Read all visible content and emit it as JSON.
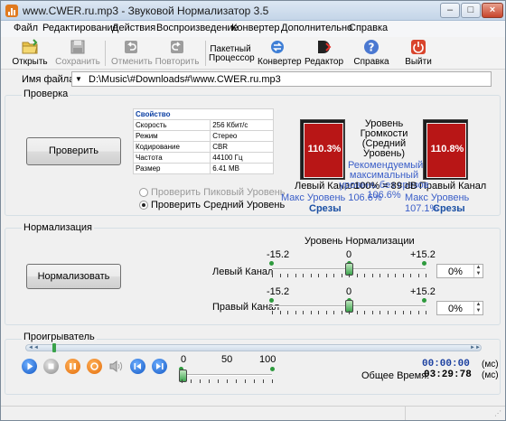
{
  "window": {
    "title": "www.CWER.ru.mp3 - Звуковой Нормализатор 3.5"
  },
  "menu": [
    "Файл",
    "Редактирование",
    "Действия",
    "Воспроизведение",
    "Конвертер",
    "Дополнительно",
    "Справка"
  ],
  "toolbar": {
    "open": "Открыть",
    "save": "Сохранить",
    "undo": "Отменить",
    "redo": "Повторить",
    "batch1": "Пакетный",
    "batch2": "Процессор",
    "converter": "Конвертер",
    "editor": "Редактор",
    "help": "Справка",
    "exit": "Выйти"
  },
  "file": {
    "label": "Имя файла:",
    "path": "D:\\Music\\#Downloads#\\www.CWER.ru.mp3"
  },
  "check": {
    "group_label": "Проверка",
    "button": "Проверить",
    "props_header": "Свойство",
    "props": [
      {
        "name": "Скорость",
        "value": "256 Кбит/с"
      },
      {
        "name": "Режим",
        "value": "Стерео"
      },
      {
        "name": "Кодирование",
        "value": "CBR"
      },
      {
        "name": "Частота",
        "value": "44100 Гц"
      },
      {
        "name": "Размер",
        "value": "6.41 MB"
      }
    ],
    "radio_peak": "Проверить Пиковый Уровень",
    "radio_avg": "Проверить Средний Уровень",
    "left_meter": "110.3%",
    "right_meter": "110.8%",
    "left_label": "Левый Канал",
    "right_label": "Правый Канал",
    "loudness_title1": "Уровень Громкости",
    "loudness_title2": "(Средний Уровень)",
    "recommend1": "Рекомендуемый",
    "recommend2": "максимальный",
    "recommend3": "уровень без срезов",
    "recommend_value": "106.6%",
    "ref": "100% = 89 dB",
    "max_left": "Макс Уровень 106.6%",
    "max_right": "Макс Уровень 107.1%",
    "clip_left": "Срезы",
    "clip_right": "Срезы"
  },
  "normalize": {
    "group_label": "Нормализация",
    "button": "Нормализовать",
    "level_title": "Уровень Нормализации",
    "scale_min": "-15.2",
    "scale_mid": "0",
    "scale_max": "+15.2",
    "left_label": "Левый Канал",
    "right_label": "Правый Канал",
    "left_value": "0%",
    "right_value": "0%"
  },
  "player": {
    "group_label": "Проигрыватель",
    "vol_min": "0",
    "vol_mid": "50",
    "vol_max": "100",
    "position": "00:00:00",
    "position_unit": "(мс)",
    "total_label": "Общее Время:",
    "total": "03:29:78",
    "total_unit": "(мс)"
  },
  "colors": {
    "accent_blue": "#1a4fa3",
    "meter_red": "#b81616",
    "link_blue": "#3a5ec8"
  }
}
